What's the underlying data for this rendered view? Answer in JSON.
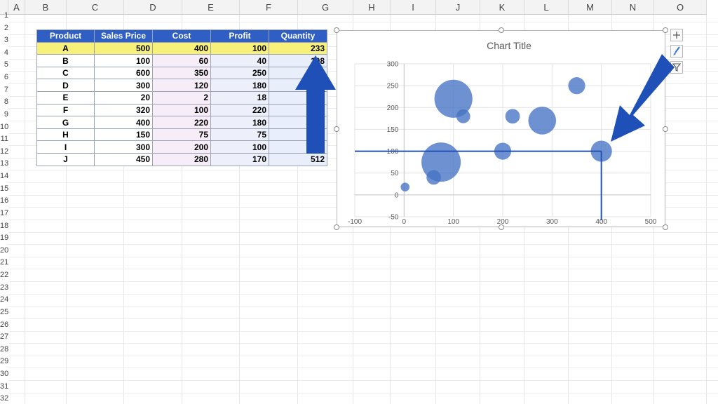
{
  "columns": [
    "A",
    "B",
    "C",
    "D",
    "E",
    "F",
    "G",
    "H",
    "I",
    "J",
    "K",
    "L",
    "M",
    "N",
    "O"
  ],
  "rows": [
    "1",
    "2",
    "3",
    "4",
    "5",
    "6",
    "7",
    "8",
    "9",
    "10",
    "11",
    "12",
    "13",
    "14",
    "15",
    "16",
    "17",
    "18",
    "19",
    "20",
    "21",
    "22",
    "23",
    "24",
    "25",
    "26",
    "27",
    "28",
    "29",
    "30",
    "31",
    "32"
  ],
  "table": {
    "headers": [
      "Product",
      "Sales Price",
      "Cost",
      "Profit",
      "Quantity"
    ],
    "rows": [
      [
        "A",
        "500",
        "400",
        "100",
        "233"
      ],
      [
        "B",
        "100",
        "60",
        "40",
        "108"
      ],
      [
        "C",
        "600",
        "350",
        "250",
        ""
      ],
      [
        "D",
        "300",
        "120",
        "180",
        ""
      ],
      [
        "E",
        "20",
        "2",
        "18",
        ""
      ],
      [
        "F",
        "320",
        "100",
        "220",
        ""
      ],
      [
        "G",
        "400",
        "220",
        "180",
        ""
      ],
      [
        "H",
        "150",
        "75",
        "75",
        ""
      ],
      [
        "I",
        "300",
        "200",
        "100",
        ""
      ],
      [
        "J",
        "450",
        "280",
        "170",
        "512"
      ]
    ]
  },
  "chart_data": {
    "type": "bubble",
    "title": "Chart Title",
    "xlim": [
      -100,
      500
    ],
    "ylim": [
      -50,
      300
    ],
    "xticks": [
      "-100",
      "0",
      "100",
      "200",
      "300",
      "400",
      "500"
    ],
    "yticks": [
      "-50",
      "0",
      "50",
      "100",
      "150",
      "200",
      "250",
      "300"
    ],
    "grid": true,
    "color": "#4472c4",
    "points": [
      {
        "x": 400,
        "y": 100,
        "size": 233
      },
      {
        "x": 60,
        "y": 40,
        "size": 108
      },
      {
        "x": 350,
        "y": 250,
        "size": 150
      },
      {
        "x": 120,
        "y": 180,
        "size": 100
      },
      {
        "x": 2,
        "y": 18,
        "size": 40
      },
      {
        "x": 100,
        "y": 220,
        "size": 750
      },
      {
        "x": 220,
        "y": 180,
        "size": 110
      },
      {
        "x": 75,
        "y": 75,
        "size": 800
      },
      {
        "x": 200,
        "y": 100,
        "size": 150
      },
      {
        "x": 280,
        "y": 170,
        "size": 400
      }
    ],
    "guide_lines": {
      "y": 100,
      "x": 400
    }
  },
  "annotation_color": "#1f50b8"
}
